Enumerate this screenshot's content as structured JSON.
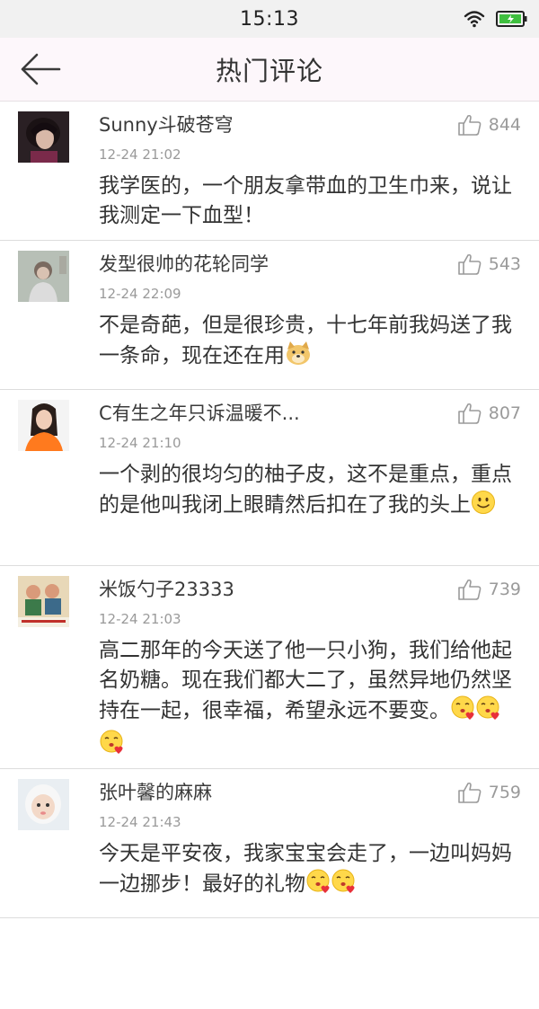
{
  "status": {
    "time": "15:13"
  },
  "header": {
    "title": "热门评论"
  },
  "comments": [
    {
      "user": "Sunny斗破苍穹",
      "time": "12-24 21:02",
      "likes": "844",
      "text": "我学医的，一个朋友拿带血的卫生巾来，说让我测定一下血型！",
      "emojis": []
    },
    {
      "user": "发型很帅的花轮同学",
      "time": "12-24 22:09",
      "likes": "543",
      "text": "不是奇葩，但是很珍贵，十七年前我妈送了我一条命，现在还在用",
      "emojis": [
        "doge"
      ]
    },
    {
      "user": "C有生之年只诉温暖不...",
      "time": "12-24 21:10",
      "likes": "807",
      "text": "一个剥的很均匀的柚子皮，这不是重点，重点的是他叫我闭上眼睛然后扣在了我的头上",
      "emojis": [
        "smile"
      ]
    },
    {
      "user": "米饭勺子23333",
      "time": "12-24 21:03",
      "likes": "739",
      "text": "高二那年的今天送了他一只小狗，我们给他起名奶糖。现在我们都大二了，虽然异地仍然坚持在一起，很幸福，希望永远不要变。",
      "emojis": [
        "kiss",
        "kiss",
        "kiss"
      ]
    },
    {
      "user": "张叶馨的麻麻",
      "time": "12-24 21:43",
      "likes": "759",
      "text": "今天是平安夜，我家宝宝会走了，一边叫妈妈一边挪步！最好的礼物",
      "emojis": [
        "kiss",
        "kiss"
      ]
    }
  ]
}
